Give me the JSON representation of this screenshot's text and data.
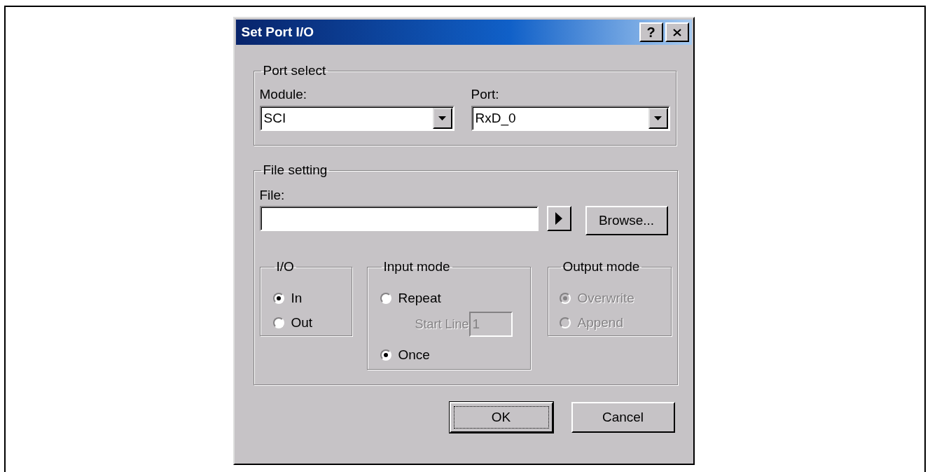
{
  "window": {
    "title": "Set Port I/O",
    "help_label": "?"
  },
  "port_select": {
    "title": "Port select",
    "module": {
      "label": "Module:",
      "value": "SCI"
    },
    "port": {
      "label": "Port:",
      "value": "RxD_0"
    }
  },
  "file_setting": {
    "title": "File setting",
    "file_label": "File:",
    "browse_button": "Browse...",
    "io": {
      "title": "I/O",
      "disabled": false,
      "options": [
        {
          "label": "In",
          "selected": true
        },
        {
          "label": "Out",
          "selected": false
        }
      ]
    },
    "input_mode": {
      "title": "Input mode",
      "disabled": false,
      "options": [
        {
          "label": "Repeat",
          "selected": false
        },
        {
          "label": "Once",
          "selected": true
        }
      ],
      "start_line": {
        "label": "Start Line",
        "value": "1",
        "disabled": true
      }
    },
    "output_mode": {
      "title": "Output mode",
      "disabled": true,
      "options": [
        {
          "label": "Overwrite",
          "selected": true
        },
        {
          "label": "Append",
          "selected": false
        }
      ]
    }
  },
  "buttons": [
    {
      "label": "OK",
      "default": true
    },
    {
      "label": "Cancel",
      "default": false
    }
  ]
}
